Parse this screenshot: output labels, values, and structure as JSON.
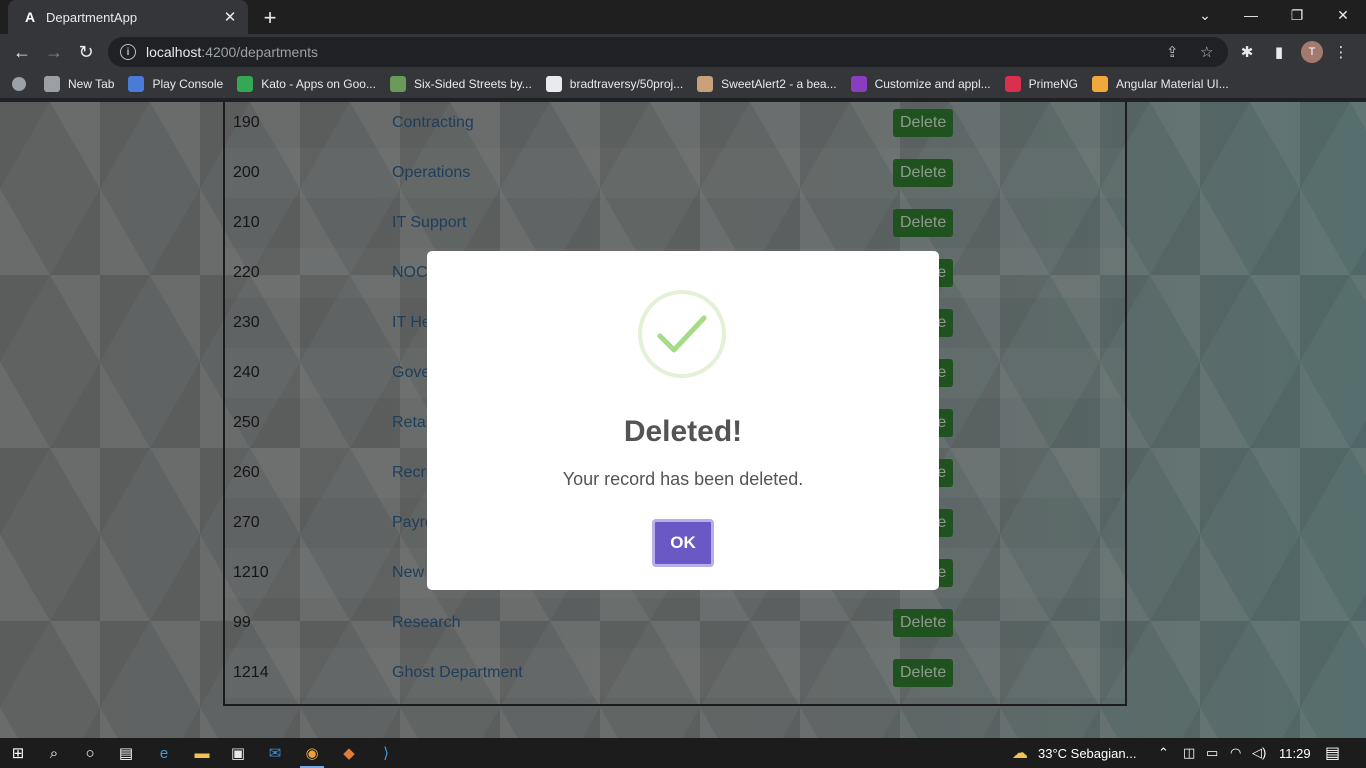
{
  "browser": {
    "tab_title": "DepartmentApp",
    "tab_close": "✕",
    "new_tab": "+",
    "url_host": "localhost",
    "url_path": ":4200/departments",
    "avatar_letter": "T",
    "bookmarks": [
      {
        "label": "New Tab",
        "color": "#9aa0a6"
      },
      {
        "label": "Play Console",
        "color": "#4a7bd8"
      },
      {
        "label": "Kato - Apps on Goo...",
        "color": "#34a853"
      },
      {
        "label": "Six-Sided Streets by...",
        "color": "#6a9a5a"
      },
      {
        "label": "bradtraversy/50proj...",
        "color": "#e8eaed"
      },
      {
        "label": "SweetAlert2 - a bea...",
        "color": "#c8a07a"
      },
      {
        "label": "Customize and appl...",
        "color": "#8a3dbf"
      },
      {
        "label": "PrimeNG",
        "color": "#d9304f"
      },
      {
        "label": "Angular Material UI...",
        "color": "#f2a93b"
      }
    ]
  },
  "departments": {
    "delete_label": "Delete",
    "rows": [
      {
        "id": "190",
        "name": "Contracting"
      },
      {
        "id": "200",
        "name": "Operations"
      },
      {
        "id": "210",
        "name": "IT Support"
      },
      {
        "id": "220",
        "name": "NOC"
      },
      {
        "id": "230",
        "name": "IT He"
      },
      {
        "id": "240",
        "name": "Gove"
      },
      {
        "id": "250",
        "name": "Retai"
      },
      {
        "id": "260",
        "name": "Recru"
      },
      {
        "id": "270",
        "name": "Payro"
      },
      {
        "id": "1210",
        "name": "New"
      },
      {
        "id": "99",
        "name": "Research"
      },
      {
        "id": "1214",
        "name": "Ghost Department"
      }
    ]
  },
  "dialog": {
    "title": "Deleted!",
    "text": "Your record has been deleted.",
    "ok_label": "OK",
    "accent": "#6a58c4",
    "success_color": "#a5dc86"
  },
  "taskbar": {
    "weather": "33°C  Sebagian...",
    "time": "11:29"
  }
}
